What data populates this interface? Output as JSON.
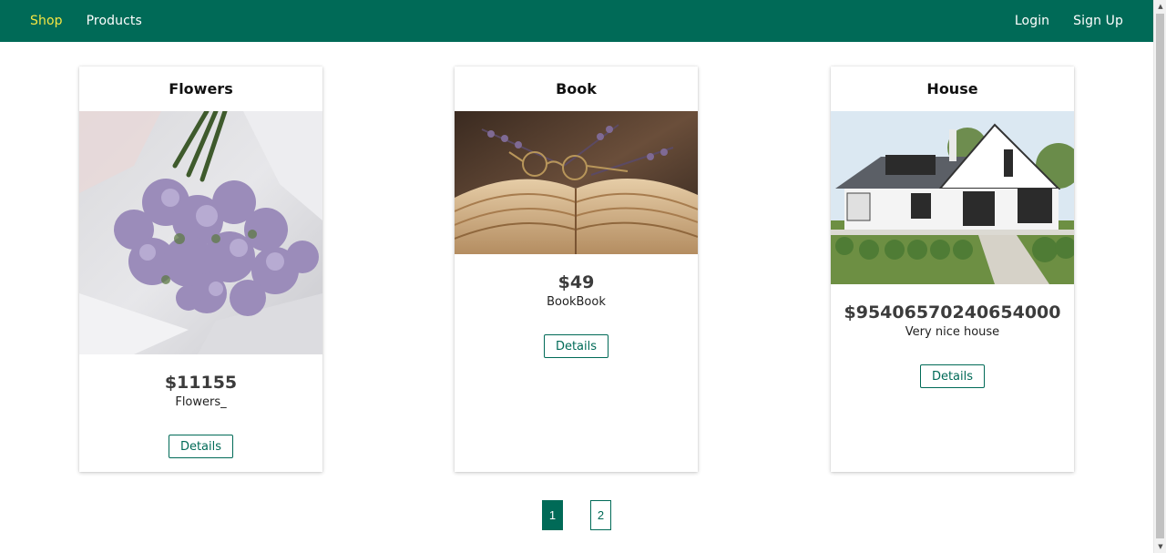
{
  "nav": {
    "brand": "Shop",
    "products": "Products",
    "login": "Login",
    "signup": "Sign Up"
  },
  "products": [
    {
      "title": "Flowers",
      "price": "$11155",
      "description": "Flowers_",
      "details_label": "Details",
      "image_icon": "flowers-photo"
    },
    {
      "title": "Book",
      "price": "$49",
      "description": "BookBook",
      "details_label": "Details",
      "image_icon": "book-photo"
    },
    {
      "title": "House",
      "price": "$95406570240654000",
      "description": "Very nice house",
      "details_label": "Details",
      "image_icon": "house-photo"
    }
  ],
  "pagination": {
    "pages": [
      "1",
      "2"
    ],
    "current": "1"
  },
  "colors": {
    "primary": "#006a57",
    "brand_text": "#f5e642",
    "price_text": "#3c3c3c"
  }
}
